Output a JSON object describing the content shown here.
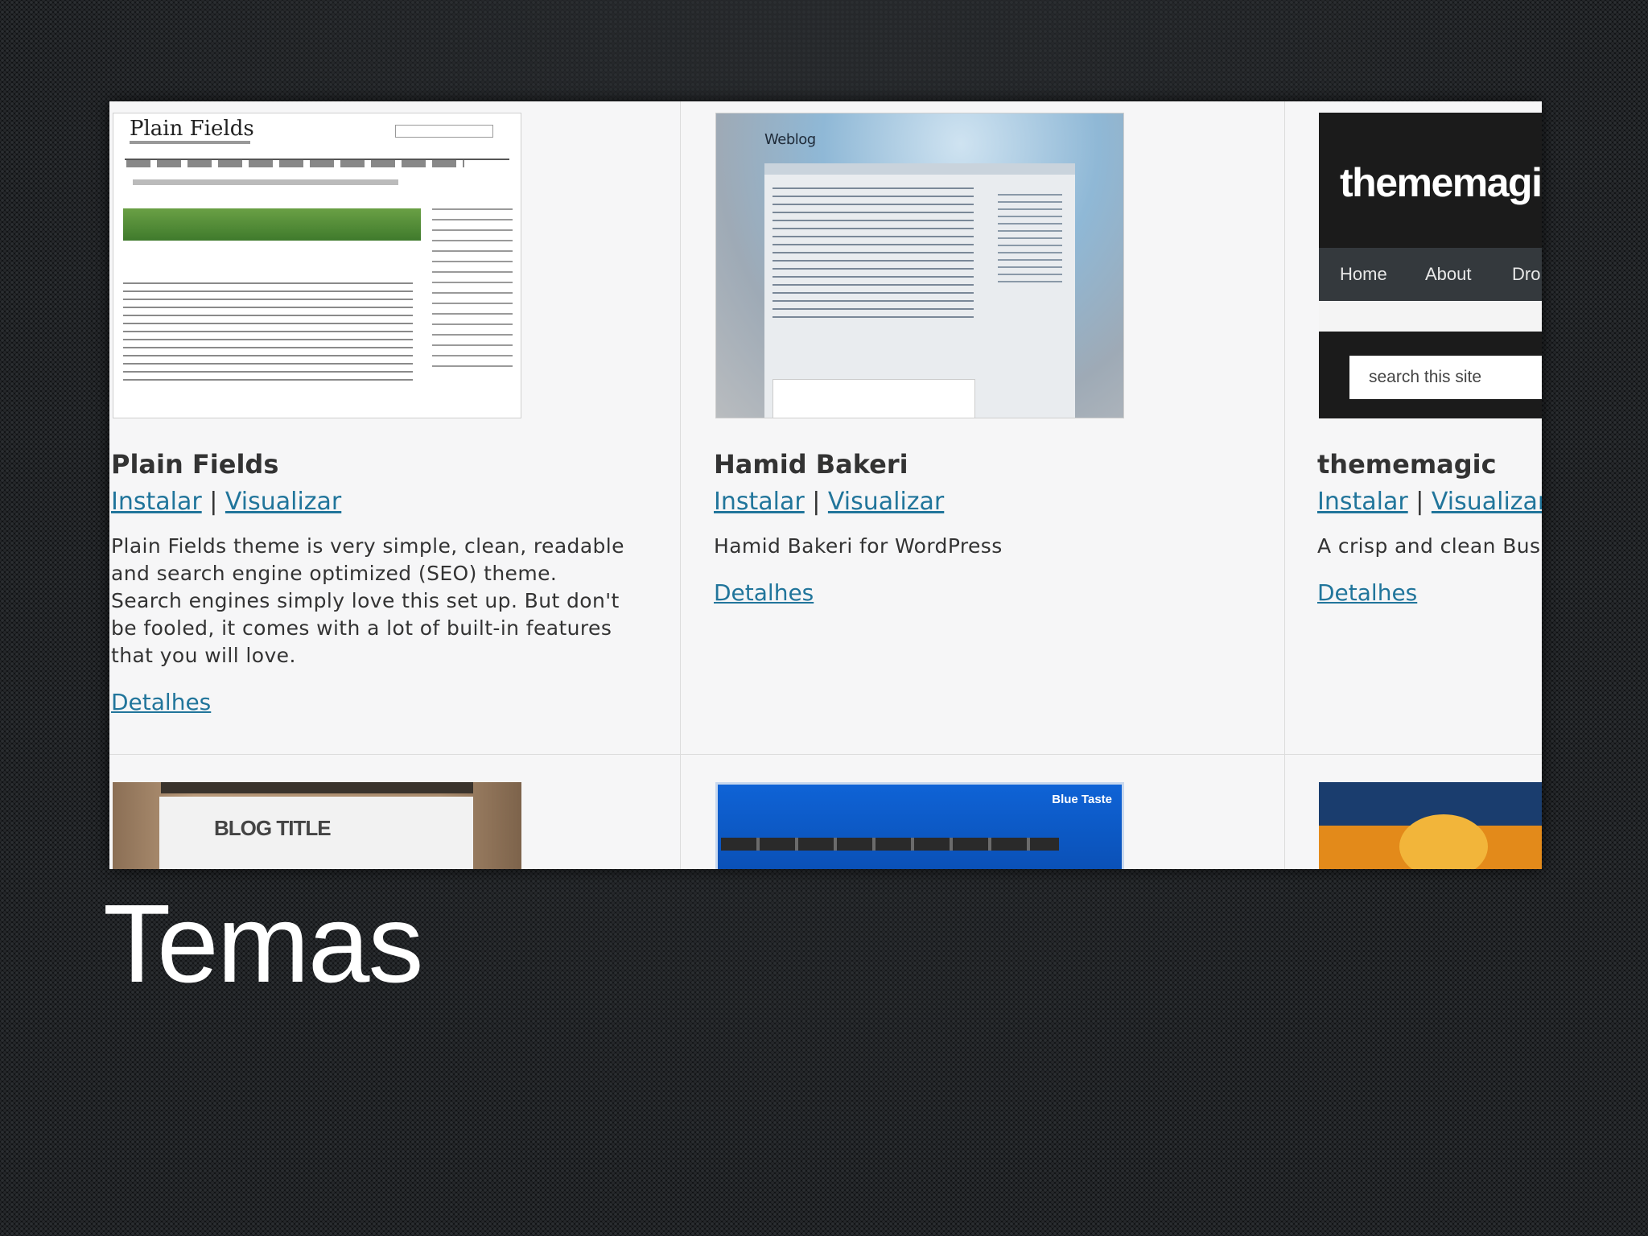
{
  "themes": [
    {
      "name": "Plain Fields",
      "install_label": "Instalar",
      "preview_label": "Visualizar",
      "description": "Plain Fields theme is very simple, clean, readable and search engine optimized (SEO) theme. Search engines simply love this set up. But don't be fooled, it comes with a lot of built-in features that you will love.",
      "details_label": "Detalhes",
      "thumbnail": {
        "site_title": "Plain Fields"
      }
    },
    {
      "name": "Hamid Bakeri",
      "install_label": "Instalar",
      "preview_label": "Visualizar",
      "description": "Hamid Bakeri for WordPress",
      "details_label": "Detalhes",
      "thumbnail": {
        "site_title": "Weblog"
      }
    },
    {
      "name": "thememagic",
      "install_label": "Instalar",
      "preview_label": "Visualizar",
      "description": "A crisp and clean Busi",
      "details_label": "Detalhes",
      "thumbnail": {
        "site_title": "thememagi",
        "nav": [
          "Home",
          "About",
          "Dro"
        ],
        "search_placeholder": "search this site"
      }
    }
  ],
  "bottom_row": [
    {
      "thumbnail_title": "BLOG TITLE"
    },
    {
      "thumbnail_title": "Blue Taste"
    },
    {
      "thumbnail_title": ""
    }
  ],
  "link_separator": "|",
  "slide_title": "Temas",
  "colors": {
    "link": "#21759b",
    "panel_background": "#f6f6f7",
    "slide_background": "#141618",
    "slide_title": "#ffffff"
  }
}
